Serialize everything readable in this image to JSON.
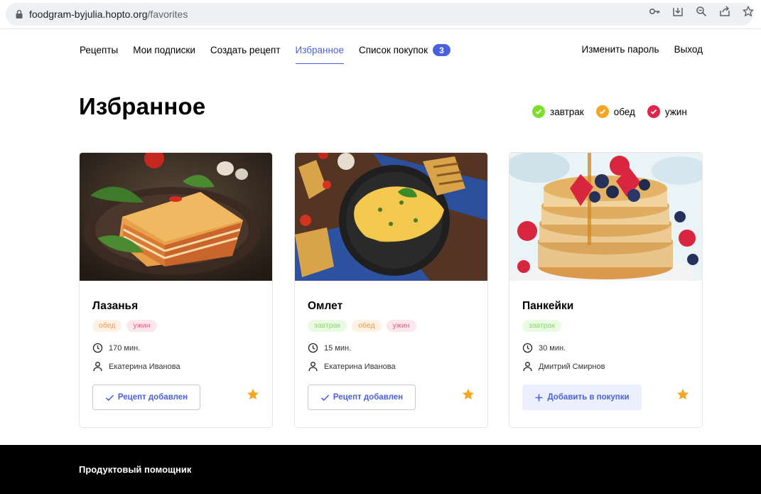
{
  "browser": {
    "url_host": "foodgram-byjulia.hopto.org",
    "url_path": "/favorites",
    "icons": [
      "key-icon",
      "download-icon",
      "zoom-icon",
      "share-icon",
      "bookmark-star-icon"
    ]
  },
  "nav": {
    "items": [
      {
        "label": "Рецепты"
      },
      {
        "label": "Мои подписки"
      },
      {
        "label": "Создать рецепт"
      },
      {
        "label": "Избранное"
      },
      {
        "label": "Список покупок"
      }
    ],
    "cart_count": "3",
    "change_password": "Изменить пароль",
    "logout": "Выход",
    "accent_color": "#4a61dd"
  },
  "page": {
    "title": "Избранное"
  },
  "legend": [
    {
      "label": "завтрак",
      "color": "#7ddf2d"
    },
    {
      "label": "обед",
      "color": "#f5a623"
    },
    {
      "label": "ужин",
      "color": "#e0244a"
    }
  ],
  "cards": [
    {
      "title": "Лазанья",
      "tags": [
        "обед",
        "ужин"
      ],
      "time": "170 мин.",
      "author": "Екатерина Иванова",
      "button": "Рецепт добавлен"
    },
    {
      "title": "Омлет",
      "tags": [
        "завтрак",
        "обед",
        "ужин"
      ],
      "time": "15 мин.",
      "author": "Екатерина Иванова",
      "button": "Рецепт добавлен"
    },
    {
      "title": "Панкейки",
      "tags": [
        "завтрак"
      ],
      "time": "30 мин.",
      "author": "Дмитрий Смирнов",
      "button": "Добавить в покупки"
    }
  ],
  "footer": {
    "text": "Продуктовый помощник"
  }
}
